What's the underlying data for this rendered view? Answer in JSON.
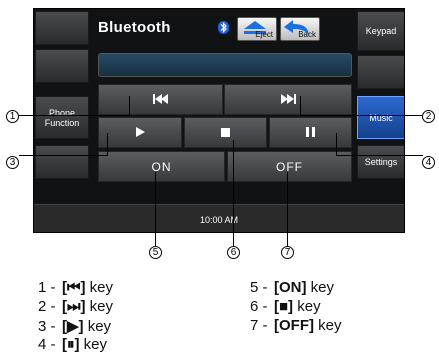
{
  "screen": {
    "title": "Bluetooth",
    "eject_label": "Eject",
    "back_label": "Back",
    "keypad_label": "Keypad",
    "phone_function_label": "Phone\nFunction",
    "music_label": "Music",
    "settings_label": "Settings",
    "on_label": "ON",
    "off_label": "OFF",
    "time": "10:00 AM",
    "colors": {
      "active_blue": "#1f56b8",
      "bluetooth_icon": "#2160d8",
      "screen_bg": "#111214"
    }
  },
  "callouts": [
    "1",
    "2",
    "3",
    "4",
    "5",
    "6",
    "7"
  ],
  "legend": [
    {
      "num": "1 -",
      "key": "[⏮]",
      "suffix": " key"
    },
    {
      "num": "2 -",
      "key": "[⏭]",
      "suffix": " key"
    },
    {
      "num": "3 -",
      "key": "[▶]",
      "suffix": " key"
    },
    {
      "num": "4 -",
      "key": "[⏸]",
      "suffix": " key"
    },
    {
      "num": "5 -",
      "key": "[ON]",
      "suffix": " key"
    },
    {
      "num": "6 -",
      "key": "[■]",
      "suffix": " key"
    },
    {
      "num": "7 -",
      "key": "[OFF]",
      "suffix": " key"
    }
  ]
}
